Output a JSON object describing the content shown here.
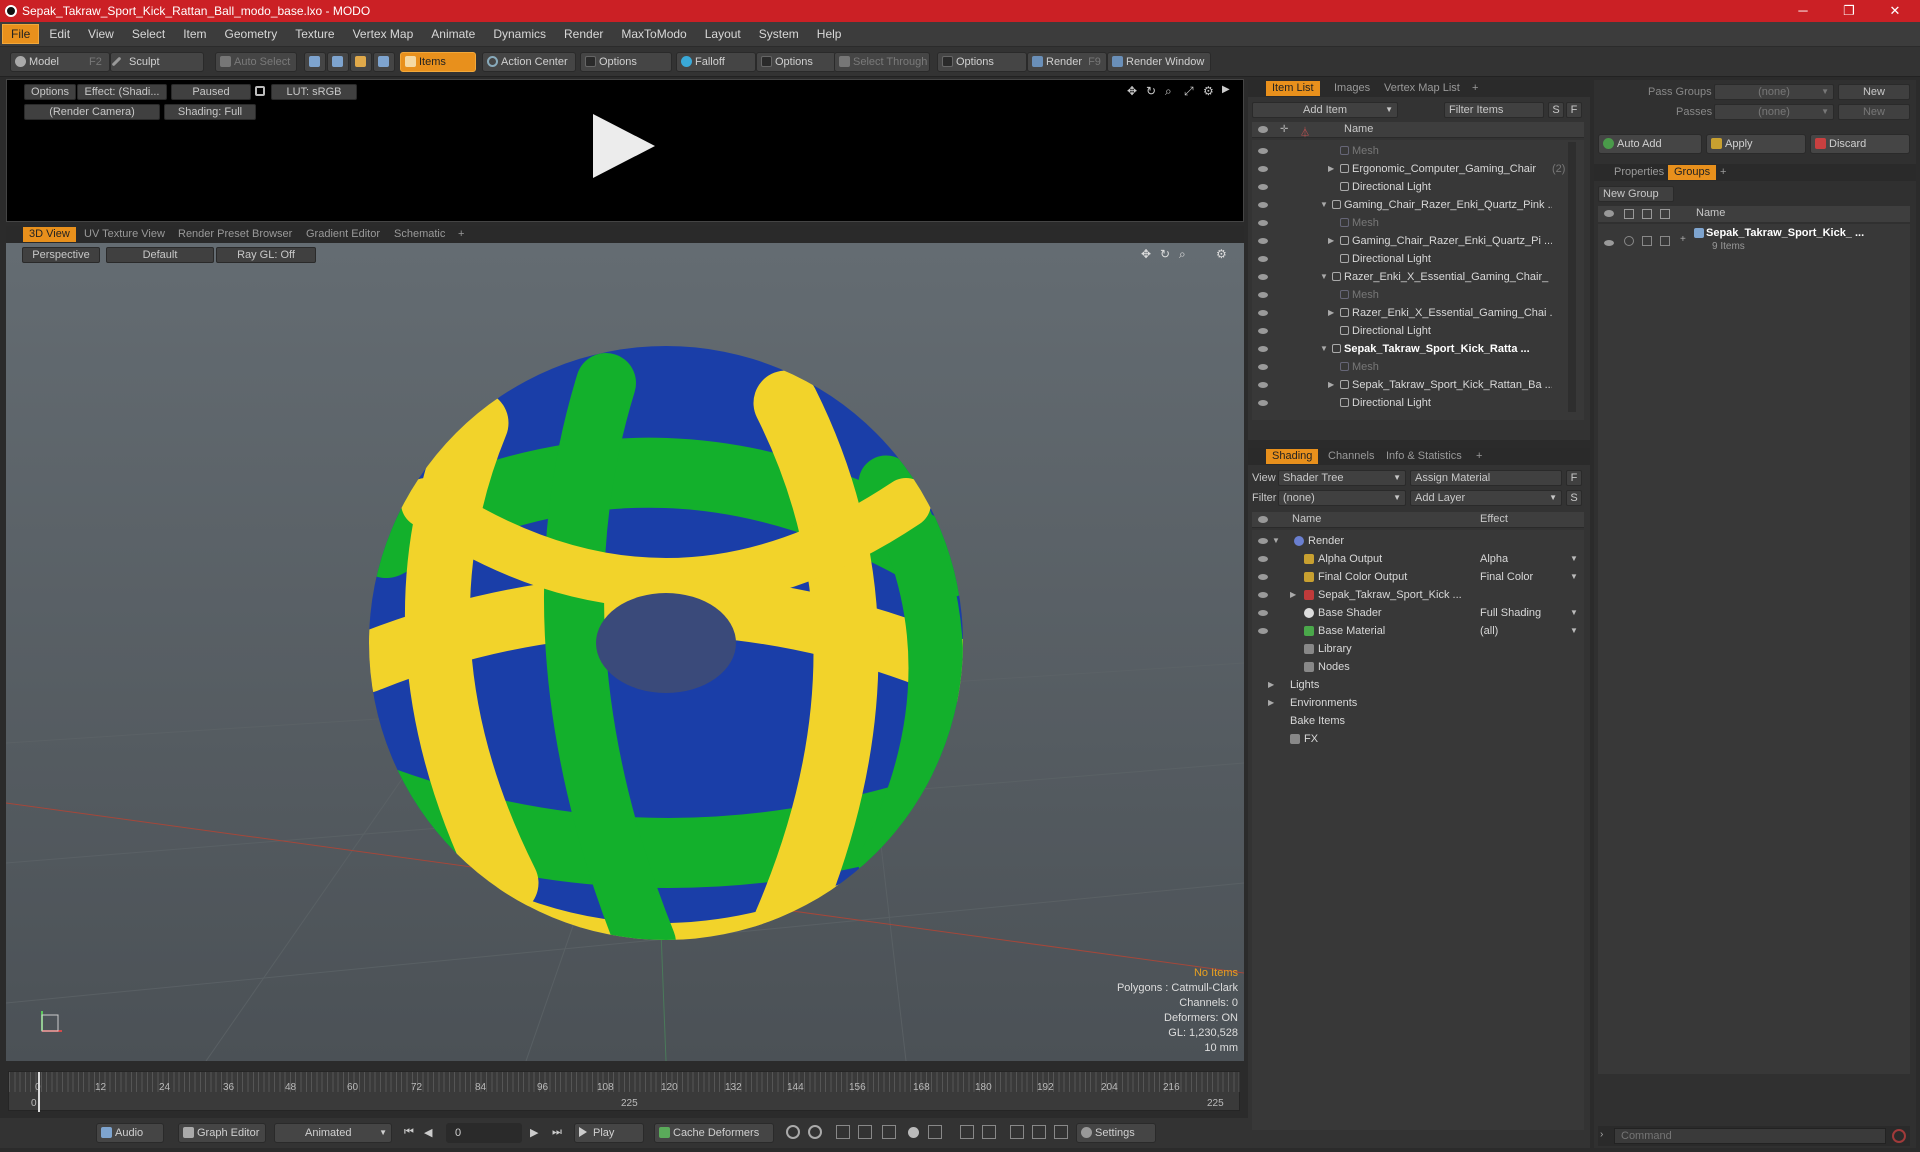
{
  "window": {
    "title": "Sepak_Takraw_Sport_Kick_Rattan_Ball_modo_base.lxo - MODO",
    "min": "─",
    "restore": "❐",
    "close": "✕"
  },
  "menu": [
    "File",
    "Edit",
    "View",
    "Select",
    "Item",
    "Geometry",
    "Texture",
    "Vertex Map",
    "Animate",
    "Dynamics",
    "Render",
    "MaxToModo",
    "Layout",
    "System",
    "Help"
  ],
  "toolbar": {
    "model": "Model",
    "model_key": "F2",
    "sculpt": "Sculpt",
    "auto_select": "Auto Select",
    "items": "Items",
    "action_center": "Action Center",
    "options1": "Options",
    "falloff": "Falloff",
    "options2": "Options",
    "select_through": "Select Through",
    "options3": "Options",
    "render": "Render",
    "render_key": "F9",
    "render_window": "Render Window"
  },
  "preview": {
    "options": "Options",
    "effect": "Effect: (Shadi...",
    "paused": "Paused",
    "lut": "LUT: sRGB",
    "camera": "(Render Camera)",
    "shading": "Shading: Full"
  },
  "viewport": {
    "tabs": [
      "3D View",
      "UV Texture View",
      "Render Preset Browser",
      "Gradient Editor",
      "Schematic"
    ],
    "perspective": "Perspective",
    "default": "Default",
    "raygl": "Ray GL: Off",
    "hud": {
      "no_items": "No Items",
      "polygons": "Polygons : Catmull-Clark",
      "channels": "Channels: 0",
      "deformers": "Deformers: ON",
      "gl": "GL: 1,230,528",
      "scale": "10 mm"
    }
  },
  "timeline": {
    "ticks": [
      "0",
      "12",
      "24",
      "36",
      "48",
      "60",
      "72",
      "84",
      "96",
      "108",
      "120",
      "132",
      "144",
      "156",
      "168",
      "180",
      "192",
      "204",
      "216"
    ],
    "start": "0",
    "end": "225",
    "mid": "225"
  },
  "bottombar": {
    "audio": "Audio",
    "graph_editor": "Graph Editor",
    "animated": "Animated",
    "frame": "0",
    "play": "Play",
    "cache": "Cache Deformers",
    "settings": "Settings"
  },
  "itemlist": {
    "tabs": [
      "Item List",
      "Images",
      "Vertex Map List"
    ],
    "add_item": "Add Item",
    "filter": "Filter Items",
    "name_header": "Name",
    "rows": [
      {
        "label": "Mesh",
        "indent": 2,
        "style": "dim"
      },
      {
        "label": "Ergonomic_Computer_Gaming_Chair",
        "count": "(2)",
        "indent": 2,
        "style": "",
        "tri": true
      },
      {
        "label": "Directional Light",
        "indent": 2,
        "style": ""
      },
      {
        "label": "Gaming_Chair_Razer_Enki_Quartz_Pink ...",
        "indent": 1,
        "style": "",
        "tri": true
      },
      {
        "label": "Mesh",
        "indent": 2,
        "style": "dim"
      },
      {
        "label": "Gaming_Chair_Razer_Enki_Quartz_Pi ...",
        "indent": 2,
        "style": "",
        "tri": true
      },
      {
        "label": "Directional Light",
        "indent": 2,
        "style": ""
      },
      {
        "label": "Razer_Enki_X_Essential_Gaming_Chair_ ...",
        "indent": 1,
        "style": "",
        "tri": true
      },
      {
        "label": "Mesh",
        "indent": 2,
        "style": "dim"
      },
      {
        "label": "Razer_Enki_X_Essential_Gaming_Chai ...",
        "indent": 2,
        "style": "",
        "tri": true
      },
      {
        "label": "Directional Light",
        "indent": 2,
        "style": ""
      },
      {
        "label": "Sepak_Takraw_Sport_Kick_Ratta ...",
        "indent": 1,
        "style": "bold",
        "tri": true
      },
      {
        "label": "Mesh",
        "indent": 2,
        "style": "dim"
      },
      {
        "label": "Sepak_Takraw_Sport_Kick_Rattan_Ba ...",
        "indent": 2,
        "style": "",
        "tri": true
      },
      {
        "label": "Directional Light",
        "indent": 2,
        "style": ""
      }
    ]
  },
  "shading": {
    "tabs": [
      "Shading",
      "Channels",
      "Info & Statistics"
    ],
    "view_label": "View",
    "view_value": "Shader Tree",
    "assign": "Assign Material",
    "filter_label": "Filter",
    "filter_value": "(none)",
    "add_layer": "Add Layer",
    "name_header": "Name",
    "effect_header": "Effect",
    "rows": [
      {
        "label": "Render",
        "effect": "",
        "indent": 0
      },
      {
        "label": "Alpha Output",
        "effect": "Alpha",
        "indent": 1
      },
      {
        "label": "Final Color Output",
        "effect": "Final Color",
        "indent": 1
      },
      {
        "label": "Sepak_Takraw_Sport_Kick ...",
        "effect": "",
        "indent": 1
      },
      {
        "label": "Base Shader",
        "effect": "Full Shading",
        "indent": 1
      },
      {
        "label": "Base Material",
        "effect": "(all)",
        "indent": 1
      },
      {
        "label": "Library",
        "effect": "",
        "indent": 1
      },
      {
        "label": "Nodes",
        "effect": "",
        "indent": 1
      },
      {
        "label": "Lights",
        "effect": "",
        "indent": 0
      },
      {
        "label": "Environments",
        "effect": "",
        "indent": 0
      },
      {
        "label": "Bake Items",
        "effect": "",
        "indent": 0
      },
      {
        "label": "FX",
        "effect": "",
        "indent": 0
      }
    ]
  },
  "groups": {
    "pass_groups": "Pass Groups",
    "pass_value": "(none)",
    "new": "New",
    "passes": "Passes",
    "passes_value": "(none)",
    "new2": "New",
    "auto_add": "Auto Add",
    "apply": "Apply",
    "discard": "Discard",
    "tabs": [
      "Properties",
      "Groups"
    ],
    "new_group": "New Group",
    "name_header": "Name",
    "item_name": "Sepak_Takraw_Sport_Kick_ ...",
    "item_count": "9 Items"
  },
  "command": {
    "placeholder": "Command"
  }
}
